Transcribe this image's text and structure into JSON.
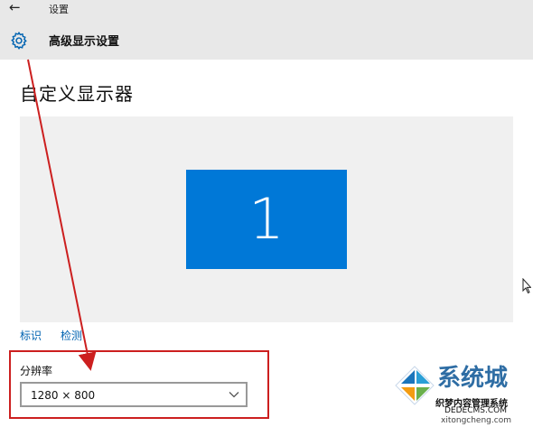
{
  "app": {
    "title": "设置",
    "back_icon": "back-arrow-icon",
    "back_glyph": "←"
  },
  "header": {
    "icon": "gear-icon",
    "title": "高级显示设置"
  },
  "main": {
    "section_title": "自定义显示器",
    "monitor_number": "1",
    "links": {
      "identify": "标识",
      "detect": "检测"
    },
    "resolution": {
      "label": "分辨率",
      "value": "1280 × 800"
    }
  },
  "watermark": {
    "line1": "系统城",
    "line2": "织梦内容管理系统",
    "line3": "DEDECMS.COM",
    "line4": "xitongcheng.com"
  },
  "colors": {
    "accent": "#0078d7",
    "link": "#0063b1",
    "annotation": "#cc1f1f",
    "header_bg": "#e8e8e8",
    "preview_bg": "#f0f0f0"
  }
}
